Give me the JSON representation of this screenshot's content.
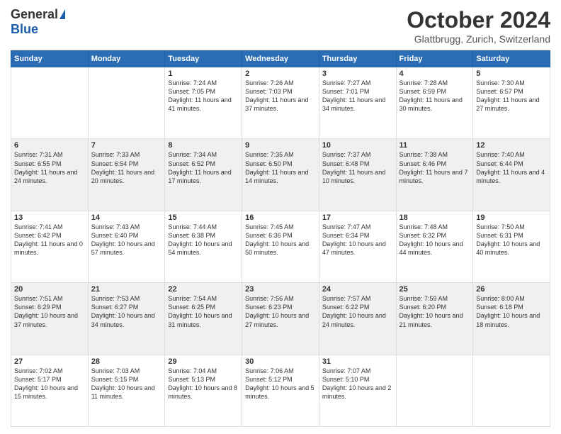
{
  "header": {
    "logo_general": "General",
    "logo_blue": "Blue",
    "month_title": "October 2024",
    "subtitle": "Glattbrugg, Zurich, Switzerland"
  },
  "weekdays": [
    "Sunday",
    "Monday",
    "Tuesday",
    "Wednesday",
    "Thursday",
    "Friday",
    "Saturday"
  ],
  "weeks": [
    [
      {
        "day": "",
        "text": ""
      },
      {
        "day": "",
        "text": ""
      },
      {
        "day": "1",
        "text": "Sunrise: 7:24 AM\nSunset: 7:05 PM\nDaylight: 11 hours and 41 minutes."
      },
      {
        "day": "2",
        "text": "Sunrise: 7:26 AM\nSunset: 7:03 PM\nDaylight: 11 hours and 37 minutes."
      },
      {
        "day": "3",
        "text": "Sunrise: 7:27 AM\nSunset: 7:01 PM\nDaylight: 11 hours and 34 minutes."
      },
      {
        "day": "4",
        "text": "Sunrise: 7:28 AM\nSunset: 6:59 PM\nDaylight: 11 hours and 30 minutes."
      },
      {
        "day": "5",
        "text": "Sunrise: 7:30 AM\nSunset: 6:57 PM\nDaylight: 11 hours and 27 minutes."
      }
    ],
    [
      {
        "day": "6",
        "text": "Sunrise: 7:31 AM\nSunset: 6:55 PM\nDaylight: 11 hours and 24 minutes."
      },
      {
        "day": "7",
        "text": "Sunrise: 7:33 AM\nSunset: 6:54 PM\nDaylight: 11 hours and 20 minutes."
      },
      {
        "day": "8",
        "text": "Sunrise: 7:34 AM\nSunset: 6:52 PM\nDaylight: 11 hours and 17 minutes."
      },
      {
        "day": "9",
        "text": "Sunrise: 7:35 AM\nSunset: 6:50 PM\nDaylight: 11 hours and 14 minutes."
      },
      {
        "day": "10",
        "text": "Sunrise: 7:37 AM\nSunset: 6:48 PM\nDaylight: 11 hours and 10 minutes."
      },
      {
        "day": "11",
        "text": "Sunrise: 7:38 AM\nSunset: 6:46 PM\nDaylight: 11 hours and 7 minutes."
      },
      {
        "day": "12",
        "text": "Sunrise: 7:40 AM\nSunset: 6:44 PM\nDaylight: 11 hours and 4 minutes."
      }
    ],
    [
      {
        "day": "13",
        "text": "Sunrise: 7:41 AM\nSunset: 6:42 PM\nDaylight: 11 hours and 0 minutes."
      },
      {
        "day": "14",
        "text": "Sunrise: 7:43 AM\nSunset: 6:40 PM\nDaylight: 10 hours and 57 minutes."
      },
      {
        "day": "15",
        "text": "Sunrise: 7:44 AM\nSunset: 6:38 PM\nDaylight: 10 hours and 54 minutes."
      },
      {
        "day": "16",
        "text": "Sunrise: 7:45 AM\nSunset: 6:36 PM\nDaylight: 10 hours and 50 minutes."
      },
      {
        "day": "17",
        "text": "Sunrise: 7:47 AM\nSunset: 6:34 PM\nDaylight: 10 hours and 47 minutes."
      },
      {
        "day": "18",
        "text": "Sunrise: 7:48 AM\nSunset: 6:32 PM\nDaylight: 10 hours and 44 minutes."
      },
      {
        "day": "19",
        "text": "Sunrise: 7:50 AM\nSunset: 6:31 PM\nDaylight: 10 hours and 40 minutes."
      }
    ],
    [
      {
        "day": "20",
        "text": "Sunrise: 7:51 AM\nSunset: 6:29 PM\nDaylight: 10 hours and 37 minutes."
      },
      {
        "day": "21",
        "text": "Sunrise: 7:53 AM\nSunset: 6:27 PM\nDaylight: 10 hours and 34 minutes."
      },
      {
        "day": "22",
        "text": "Sunrise: 7:54 AM\nSunset: 6:25 PM\nDaylight: 10 hours and 31 minutes."
      },
      {
        "day": "23",
        "text": "Sunrise: 7:56 AM\nSunset: 6:23 PM\nDaylight: 10 hours and 27 minutes."
      },
      {
        "day": "24",
        "text": "Sunrise: 7:57 AM\nSunset: 6:22 PM\nDaylight: 10 hours and 24 minutes."
      },
      {
        "day": "25",
        "text": "Sunrise: 7:59 AM\nSunset: 6:20 PM\nDaylight: 10 hours and 21 minutes."
      },
      {
        "day": "26",
        "text": "Sunrise: 8:00 AM\nSunset: 6:18 PM\nDaylight: 10 hours and 18 minutes."
      }
    ],
    [
      {
        "day": "27",
        "text": "Sunrise: 7:02 AM\nSunset: 5:17 PM\nDaylight: 10 hours and 15 minutes."
      },
      {
        "day": "28",
        "text": "Sunrise: 7:03 AM\nSunset: 5:15 PM\nDaylight: 10 hours and 11 minutes."
      },
      {
        "day": "29",
        "text": "Sunrise: 7:04 AM\nSunset: 5:13 PM\nDaylight: 10 hours and 8 minutes."
      },
      {
        "day": "30",
        "text": "Sunrise: 7:06 AM\nSunset: 5:12 PM\nDaylight: 10 hours and 5 minutes."
      },
      {
        "day": "31",
        "text": "Sunrise: 7:07 AM\nSunset: 5:10 PM\nDaylight: 10 hours and 2 minutes."
      },
      {
        "day": "",
        "text": ""
      },
      {
        "day": "",
        "text": ""
      }
    ]
  ]
}
